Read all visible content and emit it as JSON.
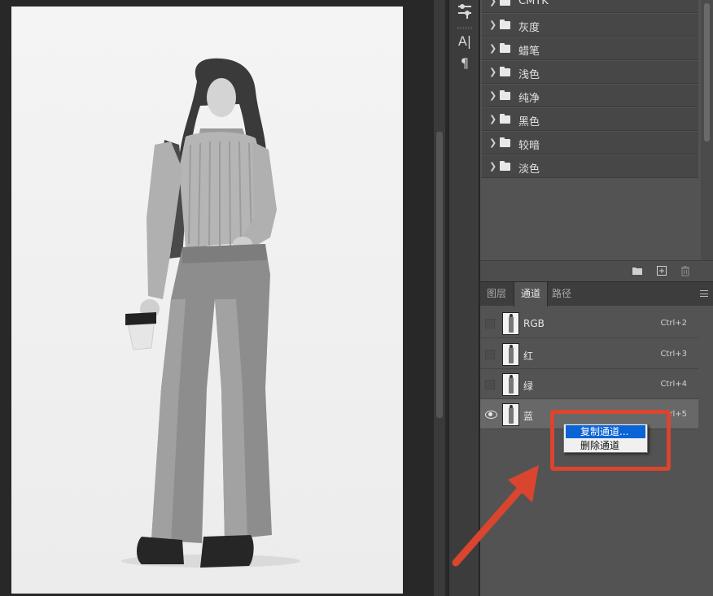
{
  "colors": {
    "panel_bg": "#535353",
    "annotation": "#d9452e",
    "menu_highlight": "#0a64d6"
  },
  "tool_strip": {
    "icons": [
      "adjustments-icon",
      "character-icon",
      "paragraph-icon"
    ],
    "character_glyph": "A|",
    "paragraph_glyph": "¶"
  },
  "swatch_folders": [
    {
      "label": "CMYK"
    },
    {
      "label": "灰度"
    },
    {
      "label": "蜡笔"
    },
    {
      "label": "浅色"
    },
    {
      "label": "纯净"
    },
    {
      "label": "黑色"
    },
    {
      "label": "较暗"
    },
    {
      "label": "淡色"
    }
  ],
  "swatch_footer": {
    "icons": [
      "new-folder-icon",
      "new-swatch-icon",
      "trash-icon"
    ]
  },
  "tabs": [
    {
      "label": "图层",
      "active": false
    },
    {
      "label": "通道",
      "active": true
    },
    {
      "label": "路径",
      "active": false
    }
  ],
  "channels": [
    {
      "name": "RGB",
      "shortcut": "Ctrl+2",
      "visible": false,
      "selected": false
    },
    {
      "name": "红",
      "shortcut": "Ctrl+3",
      "visible": false,
      "selected": false
    },
    {
      "name": "绿",
      "shortcut": "Ctrl+4",
      "visible": false,
      "selected": false
    },
    {
      "name": "蓝",
      "shortcut": "rl+5",
      "visible": true,
      "selected": true
    }
  ],
  "context_menu": {
    "items": [
      {
        "label": "复制通道...",
        "highlighted": true
      },
      {
        "label": "删除通道",
        "highlighted": false
      }
    ]
  }
}
